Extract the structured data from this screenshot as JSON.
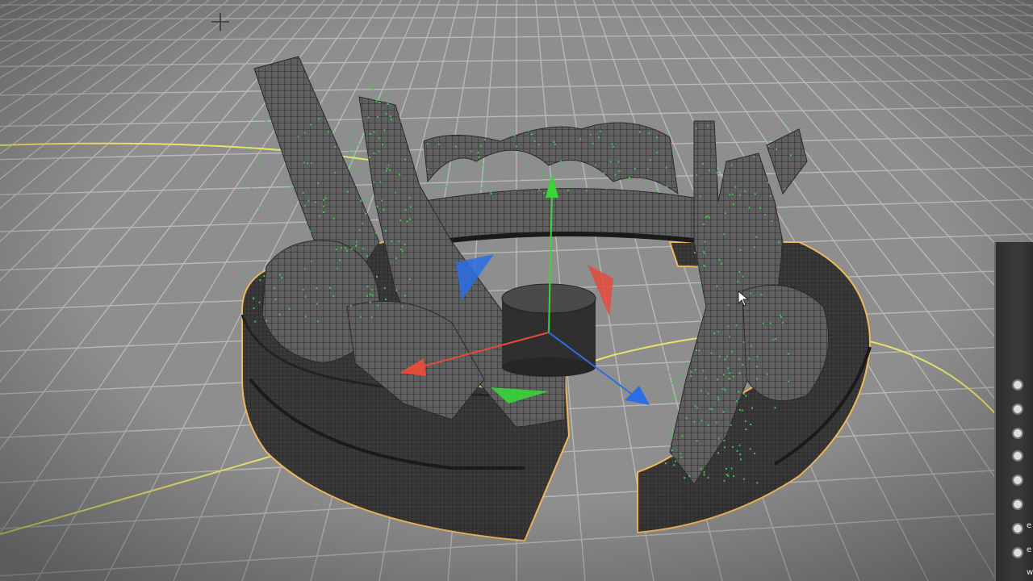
{
  "viewport": {
    "name": "perspective-viewport",
    "background_color": "#8d8d8d",
    "grid_color": "#b9b9b9",
    "selection_outline_color": "#f0b85c",
    "spline_color": "#e3e36a"
  },
  "gizmo": {
    "x_axis_color": "#e34b3b",
    "y_axis_color": "#39d639",
    "z_axis_color": "#2c6fe5"
  },
  "mesh": {
    "wire_color": "#2e2e2e",
    "face_color": "#5e5e5e",
    "selected_points_color": "#38c84a"
  },
  "side_panel": {
    "labels": [
      "e",
      "e",
      "w"
    ]
  },
  "icons": [
    "crosshair-icon",
    "mouse-cursor-icon"
  ]
}
